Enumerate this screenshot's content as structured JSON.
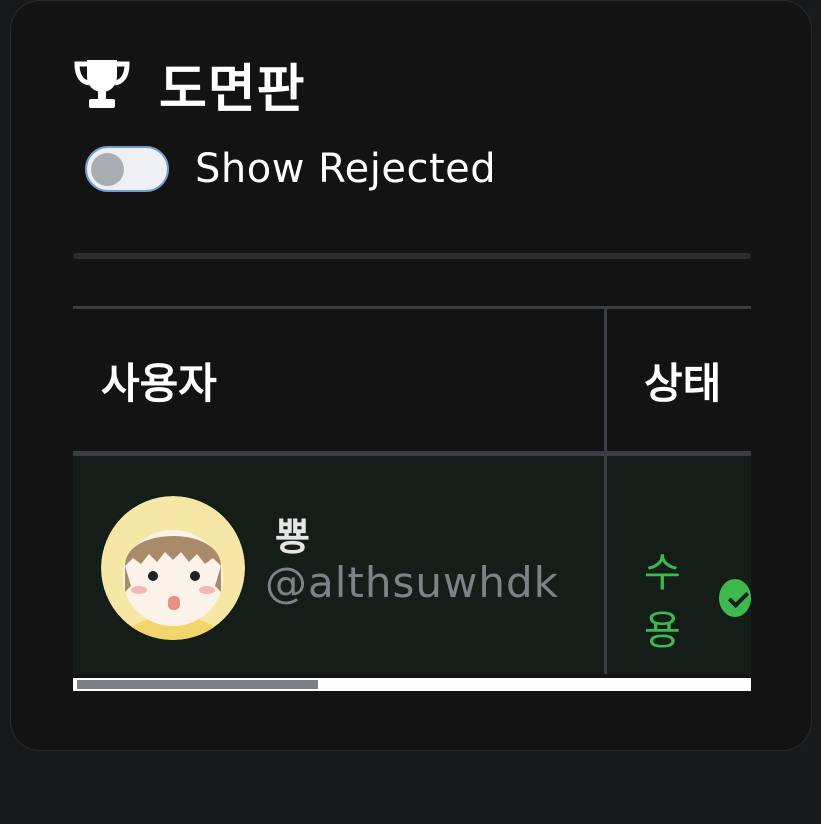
{
  "header": {
    "icon": "trophy-icon",
    "title": "도면판"
  },
  "filters": {
    "show_rejected_label": "Show Rejected",
    "show_rejected_checked": false
  },
  "table": {
    "columns": [
      "사용자",
      "상태"
    ],
    "rows": [
      {
        "display_name": "뿅",
        "handle": "@althsuwhdk",
        "status": "수용",
        "status_icon": "check-circle-icon"
      }
    ]
  },
  "colors": {
    "accent_green": "#3fb84e",
    "row_background": "#141d17",
    "toggle_border": "#6e9ed4"
  },
  "scroll": {
    "horizontal_position": 0.0,
    "visible_fraction": 0.36
  }
}
